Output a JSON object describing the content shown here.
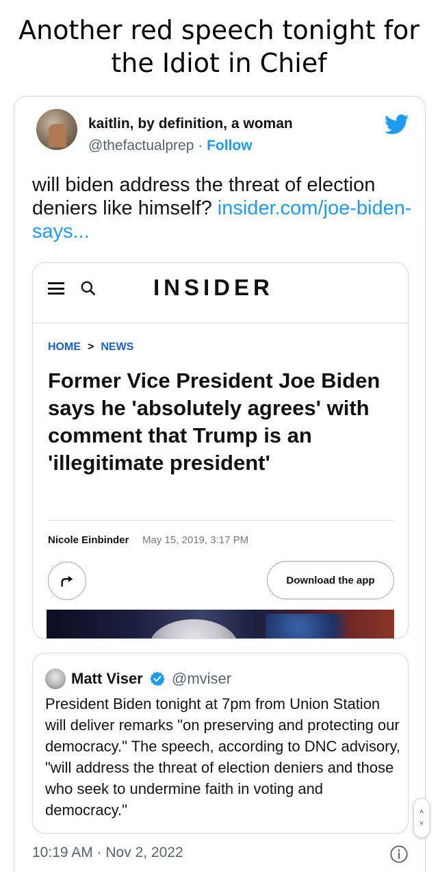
{
  "meme": {
    "caption_line1": "Another red speech tonight for",
    "caption_line2": "the Idiot in Chief"
  },
  "tweet": {
    "author_name": "kaitlin, by definition, a woman",
    "author_handle": "@thefactualprep",
    "separator": " · ",
    "follow_label": "Follow",
    "text": "will biden address the threat of election deniers like himself? ",
    "link_text": "insider.com/joe-biden-says...",
    "timestamp": "10:19 AM · Nov 2, 2022",
    "accent_color": "#1d9bf0"
  },
  "link_card": {
    "logo": "INSIDER",
    "breadcrumb_home": "HOME",
    "breadcrumb_separator": ">",
    "breadcrumb_section": "NEWS",
    "headline": "Former Vice President Joe Biden says he 'absolutely agrees' with comment that Trump is an 'illegitimate president'",
    "byline_author": "Nicole Einbinder",
    "byline_date": "May 15, 2019, 3:17 PM",
    "download_label": "Download the app",
    "icons": [
      "menu-icon",
      "search-icon",
      "share-icon"
    ]
  },
  "quote": {
    "author_name": "Matt Viser",
    "author_handle": "@mviser",
    "verified": true,
    "text": "President Biden tonight at 7pm from Union Station will deliver remarks \"on preserving and protecting our democracy.\" The speech, according to DNC advisory, \"will address the threat of election deniers and those who seek to undermine faith in voting and democracy.\""
  },
  "scroll_widget": {
    "up_glyph": "˄",
    "down_glyph": "˅"
  }
}
